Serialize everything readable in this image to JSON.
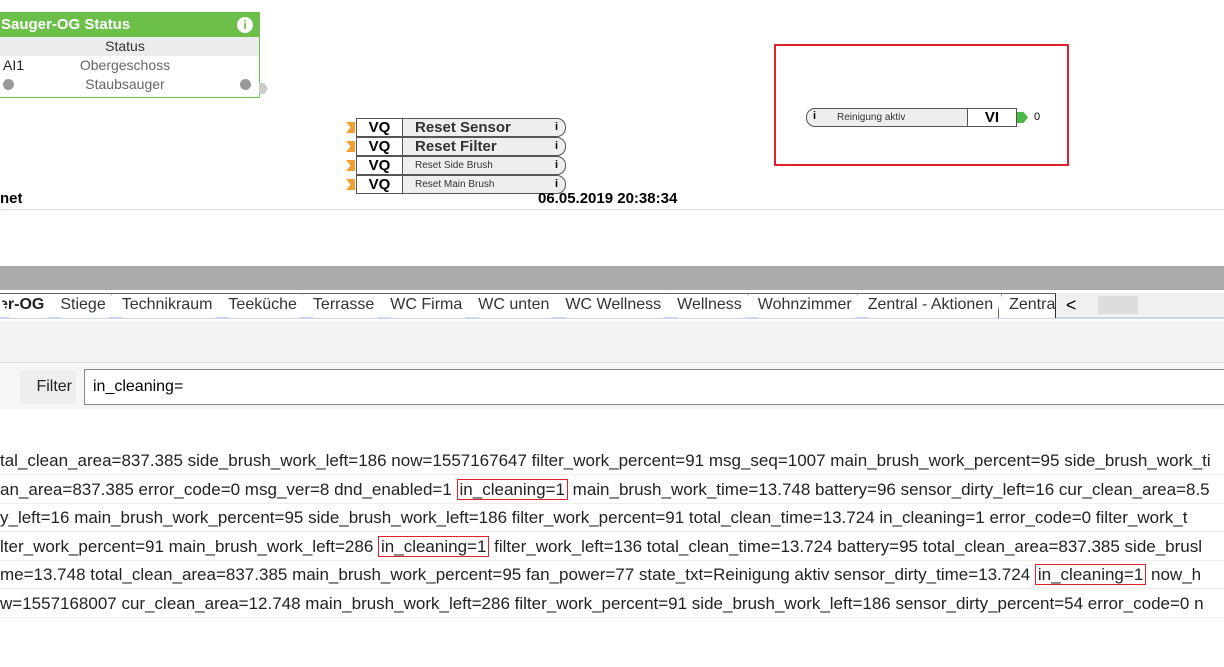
{
  "status_block": {
    "title": "Sauger-OG Status",
    "info": "i",
    "status": "Status",
    "row1_left": "AI1",
    "row1": "Obergeschoss",
    "row2": "Staubsauger"
  },
  "vq_blocks": [
    {
      "type": "VQ",
      "label": "Reset Sensor"
    },
    {
      "type": "VQ",
      "label": "Reset Filter"
    },
    {
      "type": "VQ",
      "label": "Reset Side Brush"
    },
    {
      "type": "VQ",
      "label": "Reset Main Brush"
    }
  ],
  "vi_block": {
    "label": "Reinigung aktiv",
    "type": "VI",
    "value": "0",
    "info": "i",
    "highlight_color": "#e0202a"
  },
  "footer_left": "net",
  "timestamp": "06.05.2019 20:38:34",
  "tabs": [
    "er-OG",
    "Stiege",
    "Technikraum",
    "Teeküche",
    "Terrasse",
    "WC Firma",
    "WC unten",
    "WC Wellness",
    "Wellness",
    "Wohnzimmer",
    "Zentral - Aktionen",
    "Zentra"
  ],
  "tab_scroll_left": "<",
  "filter": {
    "label": "Filter",
    "value": "in_cleaning="
  },
  "log_lines": [
    {
      "pre": "tal_clean_area=837.385 side_brush_work_left=186 now=1557167647 filter_work_percent=91 msg_seq=1007 main_brush_work_percent=95 side_brush_work_ti",
      "hl": "",
      "post": ""
    },
    {
      "pre": "an_area=837.385 error_code=0 msg_ver=8 dnd_enabled=1 ",
      "hl": "in_cleaning=1",
      "post": " main_brush_work_time=13.748 battery=96 sensor_dirty_left=16 cur_clean_area=8.5"
    },
    {
      "pre": "y_left=16 main_brush_work_percent=95 side_brush_work_left=186 filter_work_percent=91 total_clean_time=13.724 in_cleaning=1 error_code=0 filter_work_t",
      "hl": "",
      "post": ""
    },
    {
      "pre": "lter_work_percent=91 main_brush_work_left=286 ",
      "hl": "in_cleaning=1",
      "post": " filter_work_left=136 total_clean_time=13.724 battery=95 total_clean_area=837.385 side_brusl"
    },
    {
      "pre": "me=13.748 total_clean_area=837.385 main_brush_work_percent=95 fan_power=77 state_txt=Reinigung aktiv sensor_dirty_time=13.724 ",
      "hl": "in_cleaning=1",
      "post": " now_h"
    },
    {
      "pre": "w=1557168007 cur_clean_area=12.748 main_brush_work_left=286 filter_work_percent=91 side_brush_work_left=186 sensor_dirty_percent=54 error_code=0 n",
      "hl": "",
      "post": ""
    }
  ]
}
